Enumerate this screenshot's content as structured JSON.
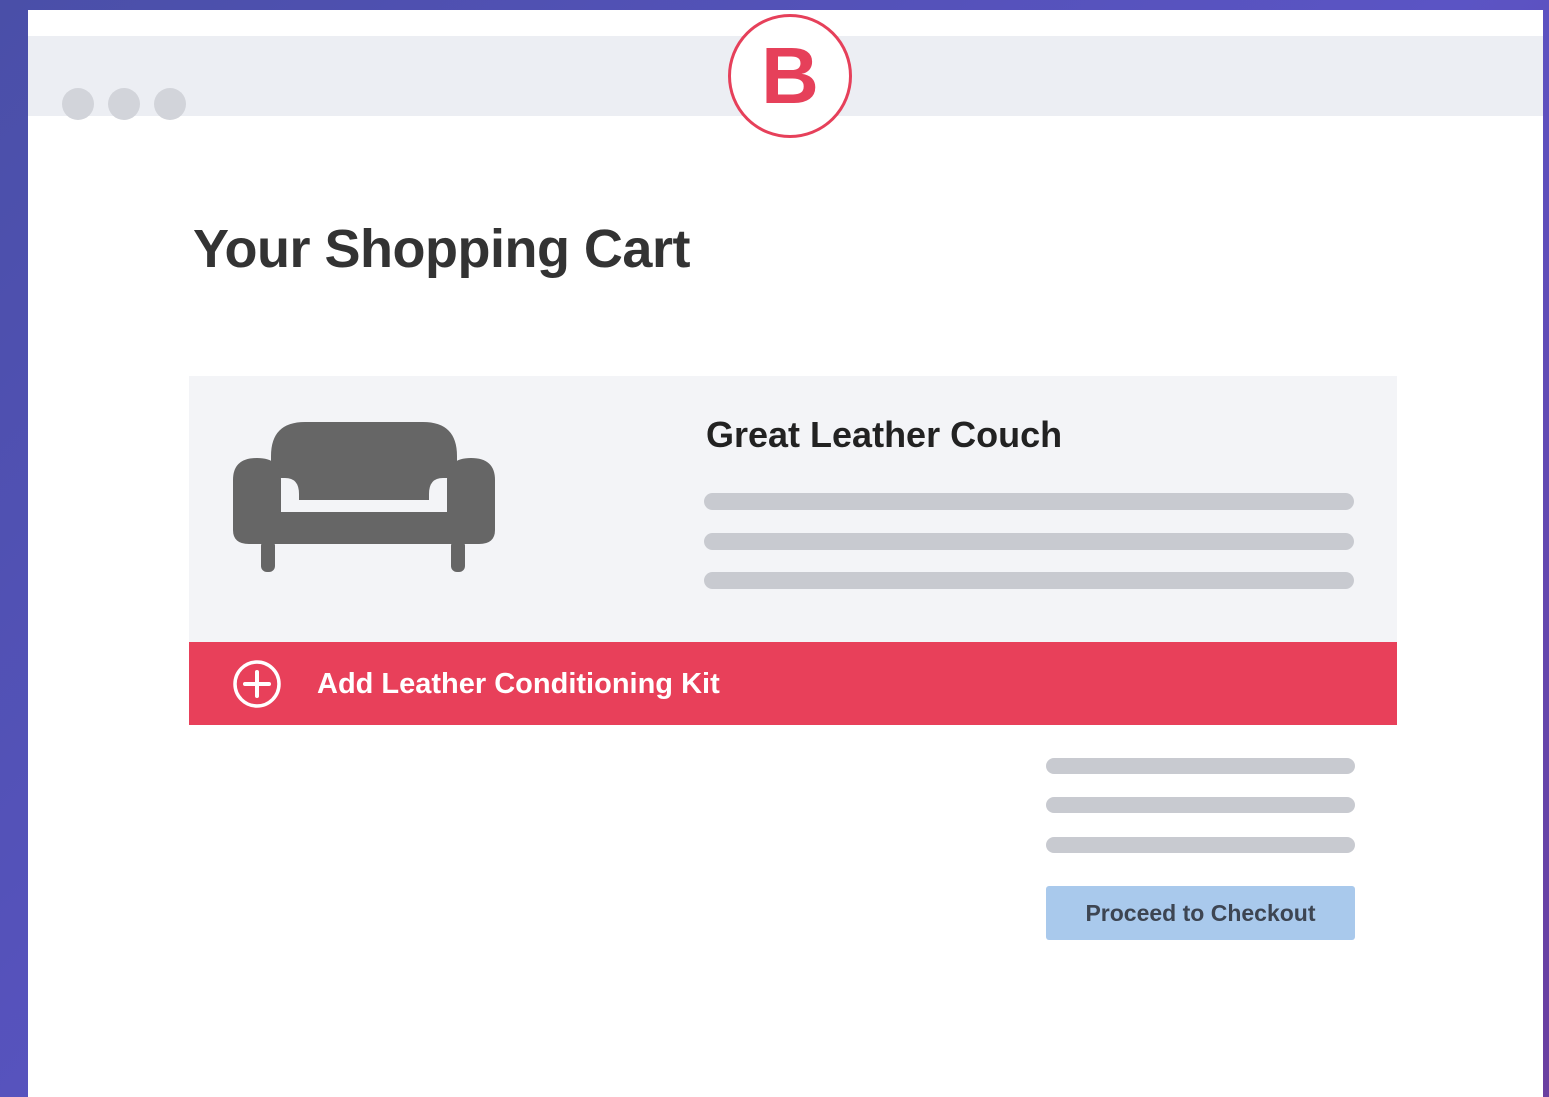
{
  "browser": {
    "window_controls": [
      "dot-icon",
      "dot-icon",
      "dot-icon"
    ],
    "variant_badge": "B"
  },
  "page": {
    "title": "Your Shopping Cart"
  },
  "cart": {
    "items": [
      {
        "name": "Great Leather Couch",
        "icon": "couch-icon"
      }
    ],
    "addon": {
      "icon": "plus-circle-icon",
      "label": "Add Leather Conditioning Kit"
    }
  },
  "actions": {
    "checkout_label": "Proceed to Checkout"
  },
  "colors": {
    "background": "#5b54c4",
    "accent": "#e8405a",
    "checkout_button": "#a9c9ec",
    "card": "#f3f4f7",
    "placeholder_line": "#c8cad0"
  }
}
